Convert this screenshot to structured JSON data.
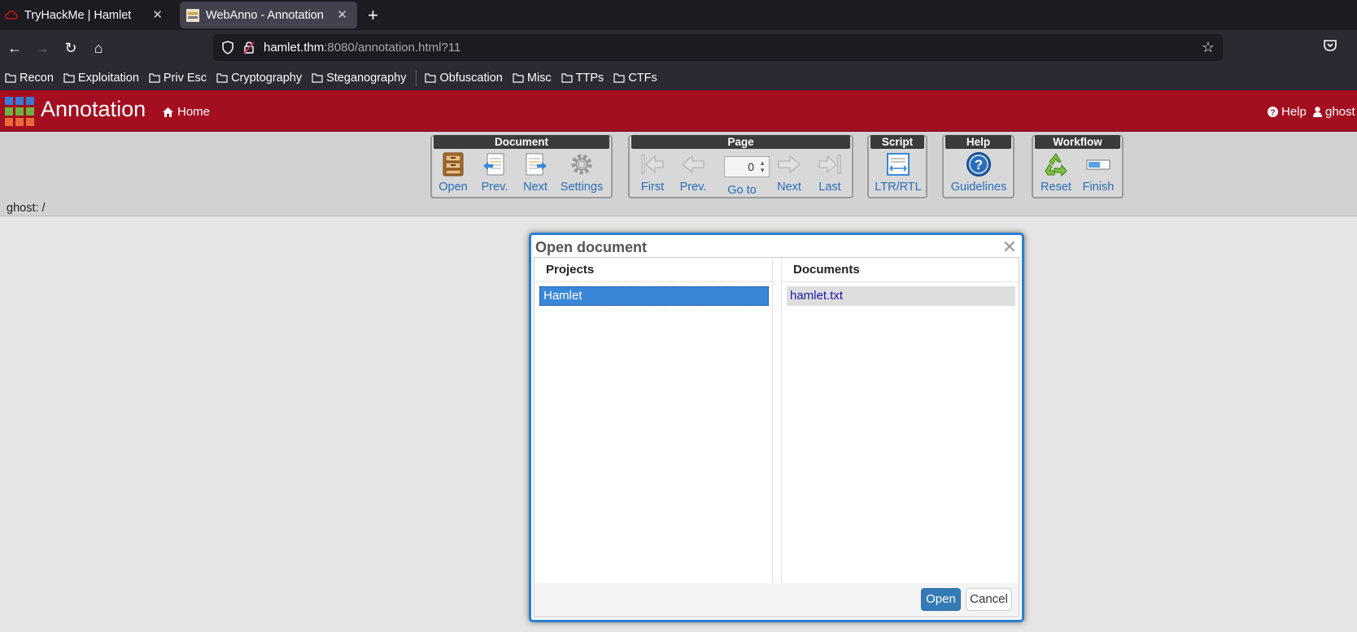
{
  "browser": {
    "tabs": [
      {
        "title": "TryHackMe | Hamlet",
        "icon": "tryhackme-cloud-icon",
        "active": false
      },
      {
        "title": "WebAnno - Annotation",
        "icon": "webanno-favicon",
        "active": true
      }
    ],
    "url": {
      "host": "hamlet.thm",
      "rest": ":8080/annotation.html?11"
    },
    "bookmarks": [
      "Recon",
      "Exploitation",
      "Priv Esc",
      "Cryptography",
      "Steganography",
      "Obfuscation",
      "Misc",
      "TTPs",
      "CTFs"
    ]
  },
  "app": {
    "title": "Annotation",
    "home_label": "Home",
    "help_label": "Help",
    "user_label": "ghost",
    "header_color": "#a30e20"
  },
  "toolbar": {
    "document": {
      "title": "Document",
      "open": "Open",
      "prev": "Prev.",
      "next": "Next",
      "settings": "Settings"
    },
    "page": {
      "title": "Page",
      "first": "First",
      "prev": "Prev.",
      "page_value": "0",
      "goto": "Go to",
      "next": "Next",
      "last": "Last"
    },
    "script": {
      "title": "Script",
      "ltr_rtl": "LTR/RTL"
    },
    "help": {
      "title": "Help",
      "guidelines": "Guidelines"
    },
    "workflow": {
      "title": "Workflow",
      "reset": "Reset",
      "finish": "Finish"
    }
  },
  "breadcrumb": "ghost: /",
  "dialog": {
    "title": "Open document",
    "projects_header": "Projects",
    "documents_header": "Documents",
    "projects": [
      "Hamlet"
    ],
    "documents": [
      "hamlet.txt"
    ],
    "open_label": "Open",
    "cancel_label": "Cancel",
    "accent_color": "#2a7fd0"
  }
}
